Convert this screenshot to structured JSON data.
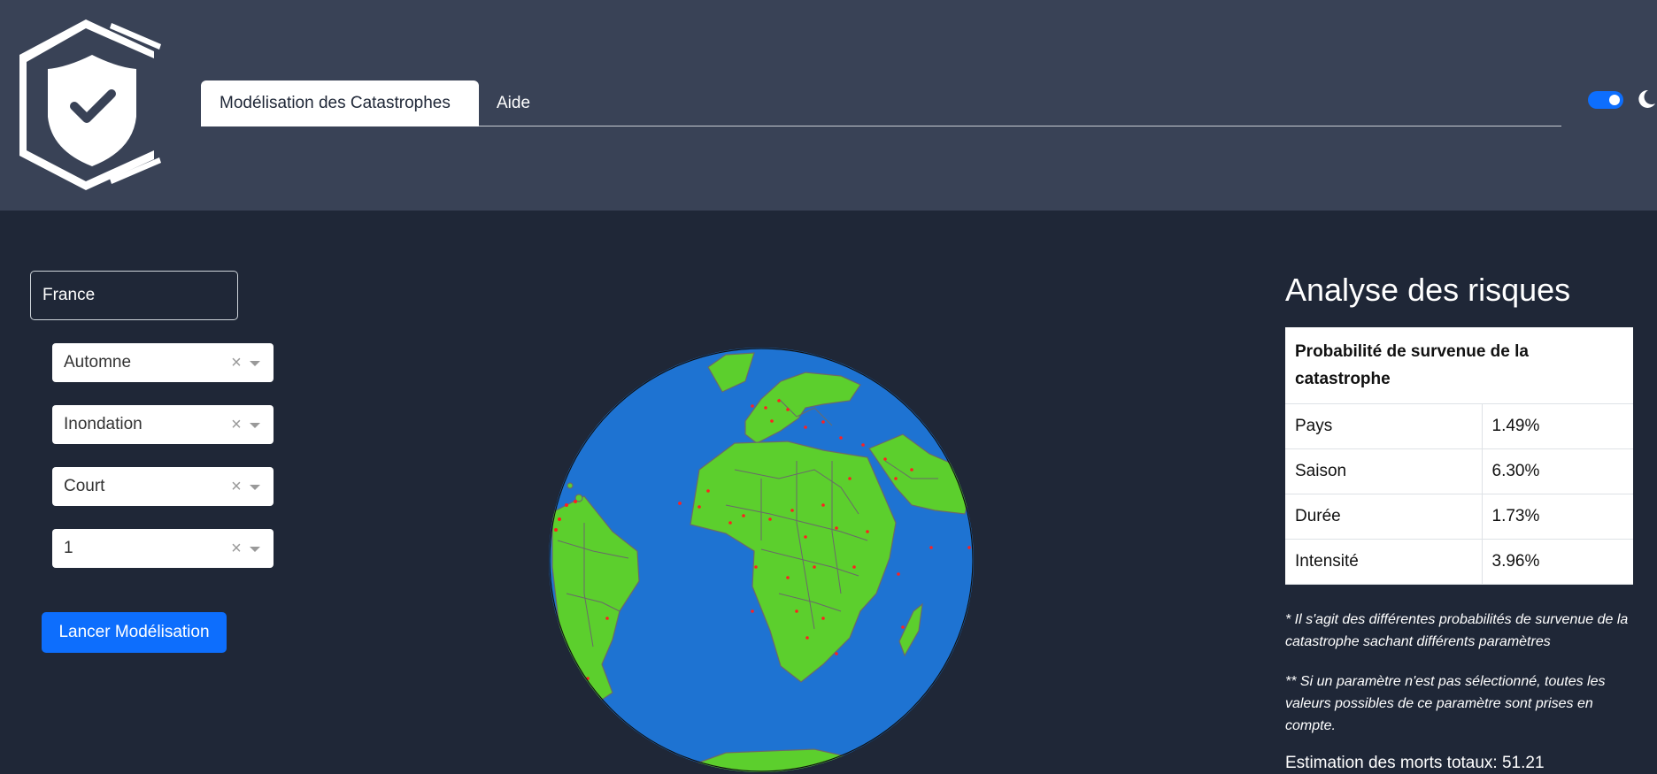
{
  "header": {
    "logo_icon": "shield-check-icon",
    "tabs": [
      {
        "label": "Modélisation des Catastrophes",
        "active": true
      },
      {
        "label": "Aide",
        "active": false
      }
    ],
    "theme_toggle": {
      "on": true,
      "icon": "moon-icon"
    }
  },
  "form": {
    "country_value": "France",
    "selects": [
      {
        "value": "Automne",
        "clear": "×"
      },
      {
        "value": "Inondation",
        "clear": "×"
      },
      {
        "value": "Court",
        "clear": "×"
      },
      {
        "value": "1",
        "clear": "×"
      }
    ],
    "submit_label": "Lancer Modélisation"
  },
  "analysis": {
    "title": "Analyse des risques",
    "table_header": "Probabilité de survenue de la catastrophe",
    "rows": [
      {
        "label": "Pays",
        "value": "1.49%"
      },
      {
        "label": "Saison",
        "value": "6.30%"
      },
      {
        "label": "Durée",
        "value": "1.73%"
      },
      {
        "label": "Intensité",
        "value": "3.96%"
      }
    ],
    "note1": "* Il s'agit des différentes probabilités de survenue de la catastrophe sachant différents paramètres",
    "note2": "** Si un paramètre n'est pas sélectionné, toutes les valeurs possibles de ce paramètre sont prises en compte.",
    "estimate": "Estimation des morts totaux: 51.21"
  },
  "colors": {
    "background": "#1f2737",
    "header": "#394256",
    "accent": "#0d6efd",
    "ocean": "#1e73d2",
    "land": "#5ccf2d",
    "event_marker": "#ff2020"
  }
}
